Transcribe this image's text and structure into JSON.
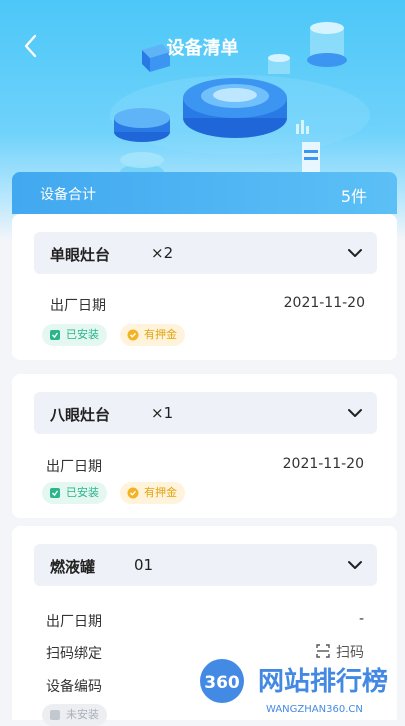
{
  "header": {
    "title": "设备清单"
  },
  "summary": {
    "label": "设备合计",
    "value": "5件"
  },
  "cards": [
    {
      "name": "单眼灶台",
      "qty": "×2",
      "date_label": "出厂日期",
      "date_value": "2021-11-20",
      "tags": [
        "已安装",
        "有押金"
      ]
    },
    {
      "name": "八眼灶台",
      "qty": "×1",
      "date_label": "出厂日期",
      "date_value": "2021-11-20",
      "tags": [
        "已安装",
        "有押金"
      ]
    },
    {
      "name": "燃液罐",
      "qty": "01",
      "date_label": "出厂日期",
      "date_value": "-",
      "scan_label": "扫码绑定",
      "scan_action": "扫码",
      "code_label": "设备编码",
      "tag": "未安装"
    }
  ],
  "watermark": {
    "brand": "网站排行榜",
    "url": "WANGZHAN360.CN",
    "logo": "360"
  },
  "colors": {
    "accent": "#42a8f0",
    "green": "#2bb58b",
    "yellow": "#e3a413"
  }
}
